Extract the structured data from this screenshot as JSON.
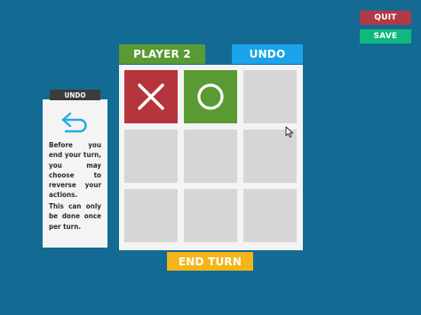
{
  "menu": {
    "quit_label": "QUIT",
    "save_label": "SAVE"
  },
  "header": {
    "player_label": "PLAYER 2",
    "undo_label": "UNDO"
  },
  "board": {
    "cells": [
      "X",
      "O",
      "",
      "",
      "",
      "",
      "",
      "",
      ""
    ]
  },
  "footer": {
    "end_turn_label": "END TURN"
  },
  "help_panel": {
    "title": "UNDO",
    "icon": "undo-arrow-icon",
    "text_1": "Before you end your turn, you may choose to reverse your actions.",
    "text_2": "This can only be done once per turn."
  },
  "colors": {
    "background": "#136b93",
    "quit": "#b03a45",
    "save": "#0fb87e",
    "player": "#5a9a33",
    "undo": "#1aa3e8",
    "x_cell": "#b6343b",
    "o_cell": "#5a9a33",
    "empty_cell": "#d6d6d6",
    "end_turn": "#f5b518"
  }
}
